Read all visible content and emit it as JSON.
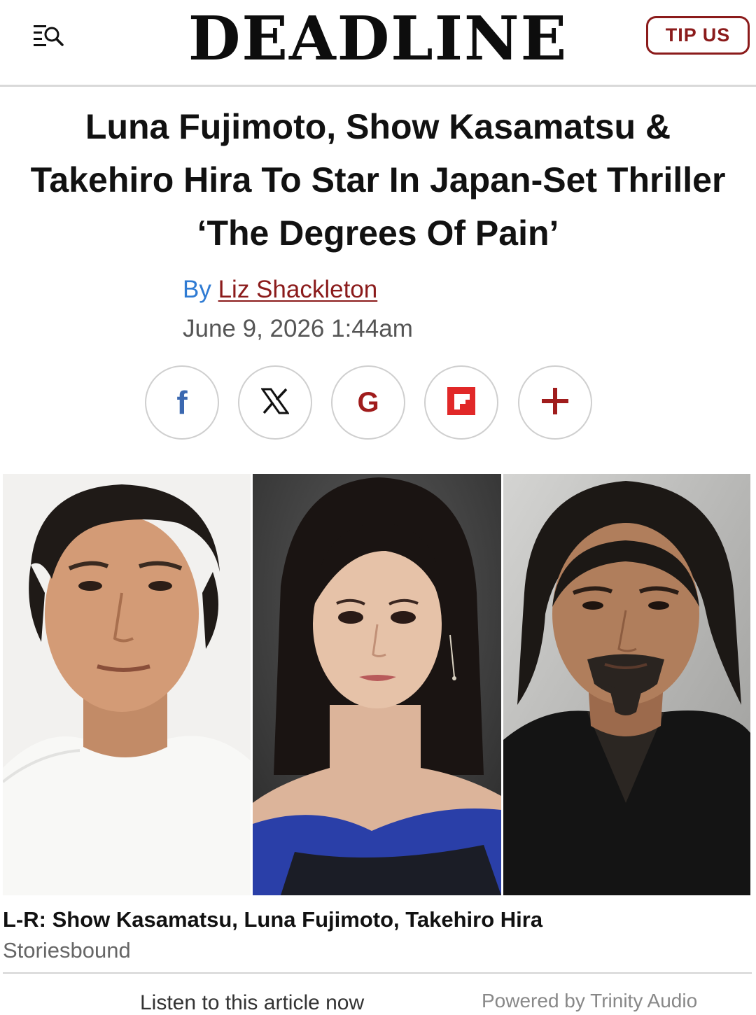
{
  "header": {
    "logo": "DEADLINE",
    "tip_label": "TIP US",
    "menu_icon": "menu-search-icon"
  },
  "article": {
    "headline": "Luna Fujimoto, Show Kasamatsu & Takehiro Hira To Star In Japan-Set Thriller ‘The Degrees Of Pain’",
    "by": "By",
    "author": "Liz Shackleton",
    "date": "June 9, 2026 1:44am"
  },
  "share": [
    {
      "icon": "facebook-icon",
      "glyph": "f",
      "color": "#3b68b0"
    },
    {
      "icon": "x-icon",
      "glyph": "𝕏",
      "color": "#111111"
    },
    {
      "icon": "google-icon",
      "glyph": "G",
      "color": "#a01c1c"
    },
    {
      "icon": "flipboard-icon",
      "glyph": "",
      "color": "#e12828"
    },
    {
      "icon": "plus-icon",
      "glyph": "+",
      "color": "#a01c1c"
    }
  ],
  "photo": {
    "caption": "L-R: Show Kasamatsu, Luna Fujimoto, Takehiro Hira",
    "credit": "Storiesbound"
  },
  "audio": {
    "listen": "Listen to this article now",
    "powered": "Powered by Trinity Audio"
  },
  "colors": {
    "brand_red": "#8b1b1b",
    "byline_blue": "#2f7bd3"
  }
}
